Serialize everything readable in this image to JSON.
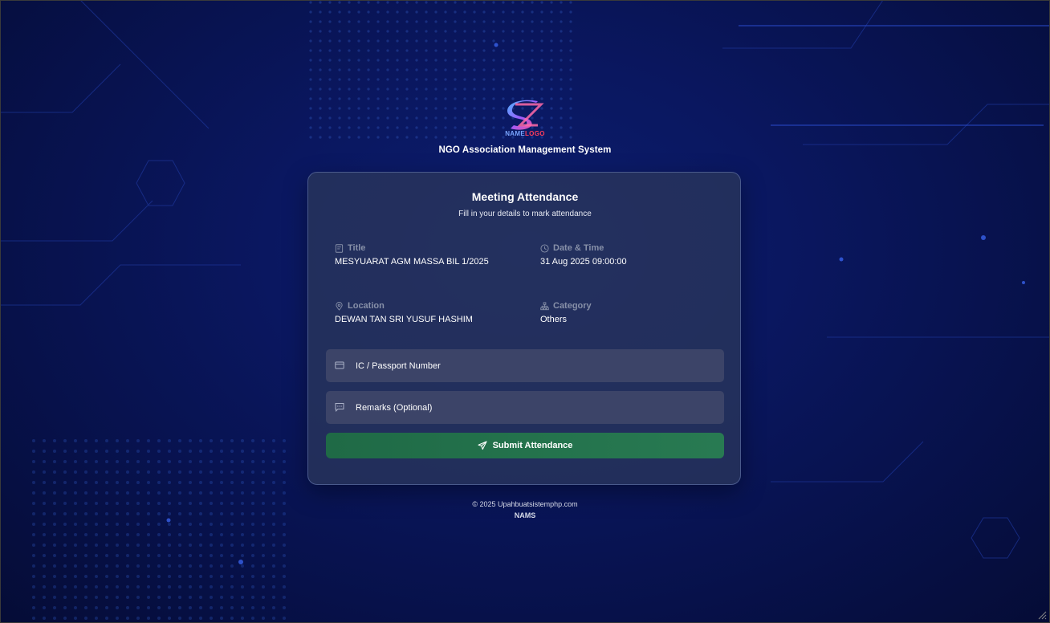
{
  "brand": {
    "logo_text_a": "NAME",
    "logo_text_b": "LOGO",
    "system_name": "NGO Association Management System"
  },
  "card": {
    "title": "Meeting Attendance",
    "subtitle": "Fill in your details to mark attendance",
    "info": {
      "title_label": "Title",
      "title_value": "MESYUARAT AGM MASSA BIL 1/2025",
      "datetime_label": "Date & Time",
      "datetime_value": "31 Aug 2025 09:00:00",
      "location_label": "Location",
      "location_value": "DEWAN TAN SRI YUSUF HASHIM",
      "category_label": "Category",
      "category_value": "Others"
    },
    "form": {
      "ic_placeholder": "IC / Passport Number",
      "ic_value": "",
      "remarks_placeholder": "Remarks (Optional)",
      "remarks_value": "",
      "submit_label": "Submit Attendance"
    }
  },
  "footer": {
    "copyright": "© 2025 Upahbuatsistemphp.com",
    "brand": "NAMS"
  },
  "colors": {
    "background": "#0a1760",
    "card": "#28345c",
    "field": "#3c4468",
    "submit": "#1f6a46"
  }
}
